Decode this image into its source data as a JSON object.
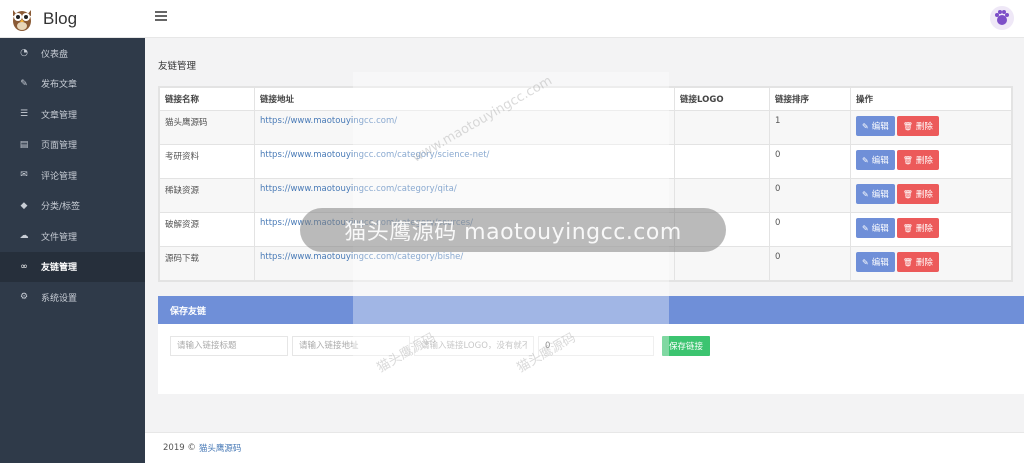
{
  "brand": {
    "title": "Blog"
  },
  "sidebar": {
    "items": [
      {
        "label": "仪表盘",
        "icon": "dashboard-icon",
        "glyph": "◔",
        "active": false
      },
      {
        "label": "发布文章",
        "icon": "edit-icon",
        "glyph": "✎",
        "active": false
      },
      {
        "label": "文章管理",
        "icon": "list-icon",
        "glyph": "☰",
        "active": false
      },
      {
        "label": "页面管理",
        "icon": "file-icon",
        "glyph": "▤",
        "active": false
      },
      {
        "label": "评论管理",
        "icon": "comments-icon",
        "glyph": "✉",
        "active": false
      },
      {
        "label": "分类/标签",
        "icon": "tags-icon",
        "glyph": "◆",
        "active": false
      },
      {
        "label": "文件管理",
        "icon": "cloud-upload-icon",
        "glyph": "☁",
        "active": false
      },
      {
        "label": "友链管理",
        "icon": "link-icon",
        "glyph": "∞",
        "active": true
      },
      {
        "label": "系统设置",
        "icon": "gear-icon",
        "glyph": "⚙",
        "active": false
      }
    ]
  },
  "page": {
    "title": "友链管理"
  },
  "table": {
    "headers": [
      "链接名称",
      "链接地址",
      "链接LOGO",
      "链接排序",
      "操作"
    ],
    "rows": [
      {
        "name": "猫头鹰源码",
        "url": "https://www.maotouyingcc.com/",
        "logo": "",
        "sort": "1"
      },
      {
        "name": "考研资料",
        "url": "https://www.maotouyingcc.com/category/science-net/",
        "logo": "",
        "sort": "0"
      },
      {
        "name": "稀缺资源",
        "url": "https://www.maotouyingcc.com/category/qita/",
        "logo": "",
        "sort": "0"
      },
      {
        "name": "破解资源",
        "url": "https://www.maotouyingcc.com/category/sources/",
        "logo": "",
        "sort": "0"
      },
      {
        "name": "源码下载",
        "url": "https://www.maotouyingcc.com/category/bishe/",
        "logo": "",
        "sort": "0"
      }
    ],
    "edit_label": "编辑",
    "delete_label": "删除"
  },
  "form": {
    "title": "保存友链",
    "title_placeholder": "请输入链接标题",
    "url_placeholder": "请输入链接地址",
    "logo_placeholder": "请输入链接LOGO，没有就不填",
    "sort_value": "0",
    "save_label": "保存链接"
  },
  "footer": {
    "copyright": "2019 ©",
    "link": "猫头鹰源码"
  },
  "watermark": {
    "banner": "猫头鹰源码 maotouyingcc.com",
    "small": "猫头鹰源码",
    "url": "www.maotouyingcc.com"
  },
  "colors": {
    "sidebar": "#2f3a49",
    "accent": "#6f8fd8",
    "danger": "#ec5a5a",
    "success": "#3cc470"
  }
}
